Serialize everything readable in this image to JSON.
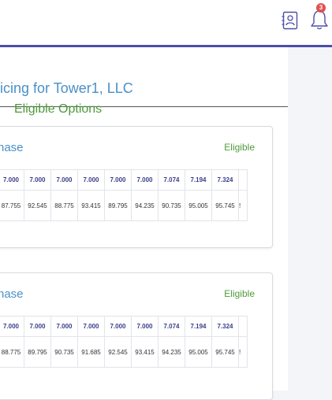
{
  "header": {
    "notification_count": "3",
    "icons": [
      "contact-book-icon",
      "bell-icon"
    ],
    "accent_color": "#4b4fa8"
  },
  "page": {
    "title": "icing for Tower1, LLC",
    "subtitle": "Eligible Options"
  },
  "cards": [
    {
      "title": "hase",
      "status": "Eligible",
      "rates": [
        "7.000",
        "7.000",
        "7.000",
        "7.000",
        "7.000",
        "7.000",
        "7.074",
        "7.194",
        "7.324",
        ""
      ],
      "prices": [
        "87.755",
        "92.545",
        "88.775",
        "93.415",
        "89.795",
        "94.235",
        "90.735",
        "95.005",
        "95.745",
        "!"
      ]
    },
    {
      "title": "nase",
      "status": "Eligible",
      "rates": [
        "7.000",
        "7.000",
        "7.000",
        "7.000",
        "7.000",
        "7.000",
        "7.074",
        "7.194",
        "7.324",
        ""
      ],
      "prices": [
        "88.775",
        "89.795",
        "90.735",
        "91.685",
        "92.545",
        "93.415",
        "94.235",
        "95.005",
        "95.745",
        "!"
      ]
    }
  ],
  "colors": {
    "title_blue": "#4a90c8",
    "eligible_green": "#4e9a3a",
    "rate_navy": "#3a3e8c"
  }
}
